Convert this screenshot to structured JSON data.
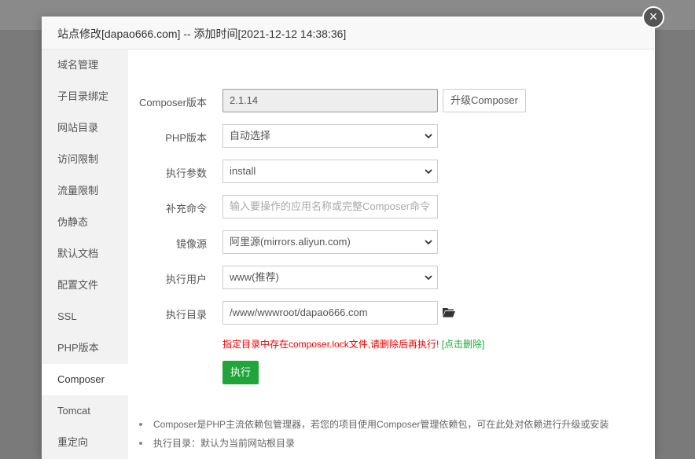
{
  "dialog": {
    "title": "站点修改[dapao666.com] -- 添加时间[2021-12-12 14:38:36]",
    "close": "×"
  },
  "sidebar": {
    "items": [
      {
        "label": "域名管理"
      },
      {
        "label": "子目录绑定"
      },
      {
        "label": "网站目录"
      },
      {
        "label": "访问限制"
      },
      {
        "label": "流量限制"
      },
      {
        "label": "伪静态"
      },
      {
        "label": "默认文档"
      },
      {
        "label": "配置文件"
      },
      {
        "label": "SSL"
      },
      {
        "label": "PHP版本"
      },
      {
        "label": "Composer"
      },
      {
        "label": "Tomcat"
      },
      {
        "label": "重定向"
      }
    ],
    "active_index": 10
  },
  "form": {
    "composer_version": {
      "label": "Composer版本",
      "value": "2.1.14",
      "upgrade_label": "升级Composer"
    },
    "php_version": {
      "label": "PHP版本",
      "selected": "自动选择"
    },
    "exec_args": {
      "label": "执行参数",
      "selected": "install"
    },
    "extra_cmd": {
      "label": "补充命令",
      "placeholder": "输入要操作的应用名称或完整Composer命令"
    },
    "mirror": {
      "label": "镜像源",
      "selected": "阿里源(mirrors.aliyun.com)"
    },
    "exec_user": {
      "label": "执行用户",
      "selected": "www(推荐)"
    },
    "exec_dir": {
      "label": "执行目录",
      "value": "/www/wwwroot/dapao666.com"
    },
    "warning": "指定目录中存在composer.lock文件,请删除后再执行!",
    "warning_link": "[点击删除]",
    "run_label": "执行"
  },
  "notes": [
    "Composer是PHP主流依赖包管理器，若您的项目使用Composer管理依赖包，可在此处对依赖进行升级或安装",
    "执行目录：默认为当前网站根目录"
  ],
  "colors": {
    "primary": "#20a53a",
    "warning": "#ee0000"
  },
  "icons": {
    "close": "close-icon",
    "folder": "folder-icon",
    "dropdown": "chevron-down-icon"
  }
}
